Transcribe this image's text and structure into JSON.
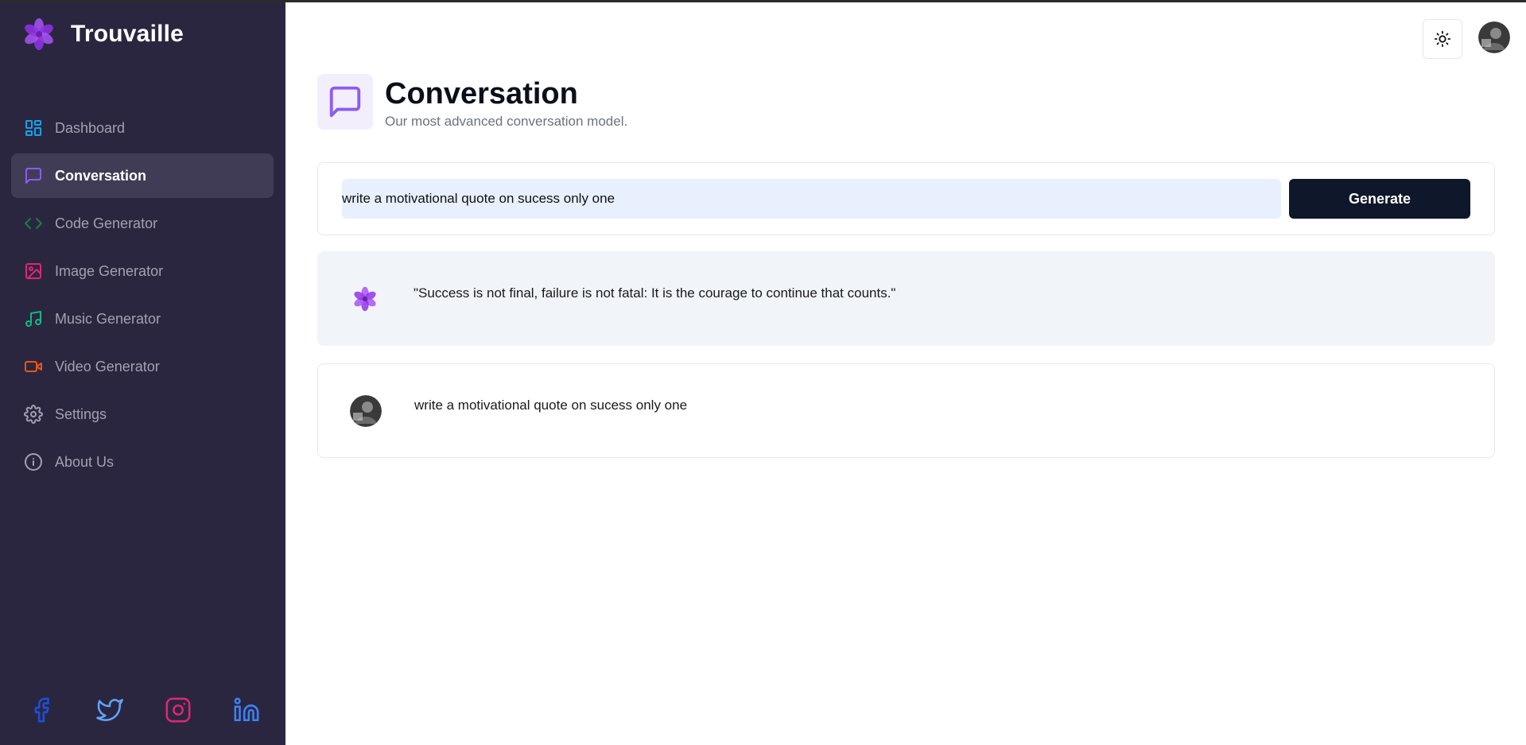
{
  "app": {
    "name": "Trouvaille"
  },
  "sidebar": {
    "items": [
      {
        "label": "Dashboard",
        "icon": "dashboard-icon",
        "color": "#0ea5e9"
      },
      {
        "label": "Conversation",
        "icon": "message-icon",
        "color": "#8b5cf6",
        "active": true
      },
      {
        "label": "Code Generator",
        "icon": "code-icon",
        "color": "#15803d"
      },
      {
        "label": "Image Generator",
        "icon": "image-icon",
        "color": "#db2777"
      },
      {
        "label": "Music Generator",
        "icon": "music-icon",
        "color": "#10b981"
      },
      {
        "label": "Video Generator",
        "icon": "video-icon",
        "color": "#ea580c"
      },
      {
        "label": "Settings",
        "icon": "gear-icon",
        "color": "#a2a1ad"
      },
      {
        "label": "About Us",
        "icon": "info-icon",
        "color": "#a2a1ad"
      }
    ],
    "social": [
      {
        "icon": "facebook-icon",
        "color": "#1d4ed8"
      },
      {
        "icon": "twitter-icon",
        "color": "#60a5fa"
      },
      {
        "icon": "instagram-icon",
        "color": "#db2777"
      },
      {
        "icon": "linkedin-icon",
        "color": "#3b82f6"
      }
    ]
  },
  "header": {
    "title": "Conversation",
    "subtitle": "Our most advanced conversation model.",
    "accent": "#8b5cf6"
  },
  "form": {
    "prompt_value": "write a motivational quote on sucess only one",
    "button_label": "Generate"
  },
  "messages": [
    {
      "role": "bot",
      "text": "\"Success is not final, failure is not fatal: It is the courage to continue that counts.\""
    },
    {
      "role": "user",
      "text": "write a motivational quote on sucess only one"
    }
  ]
}
